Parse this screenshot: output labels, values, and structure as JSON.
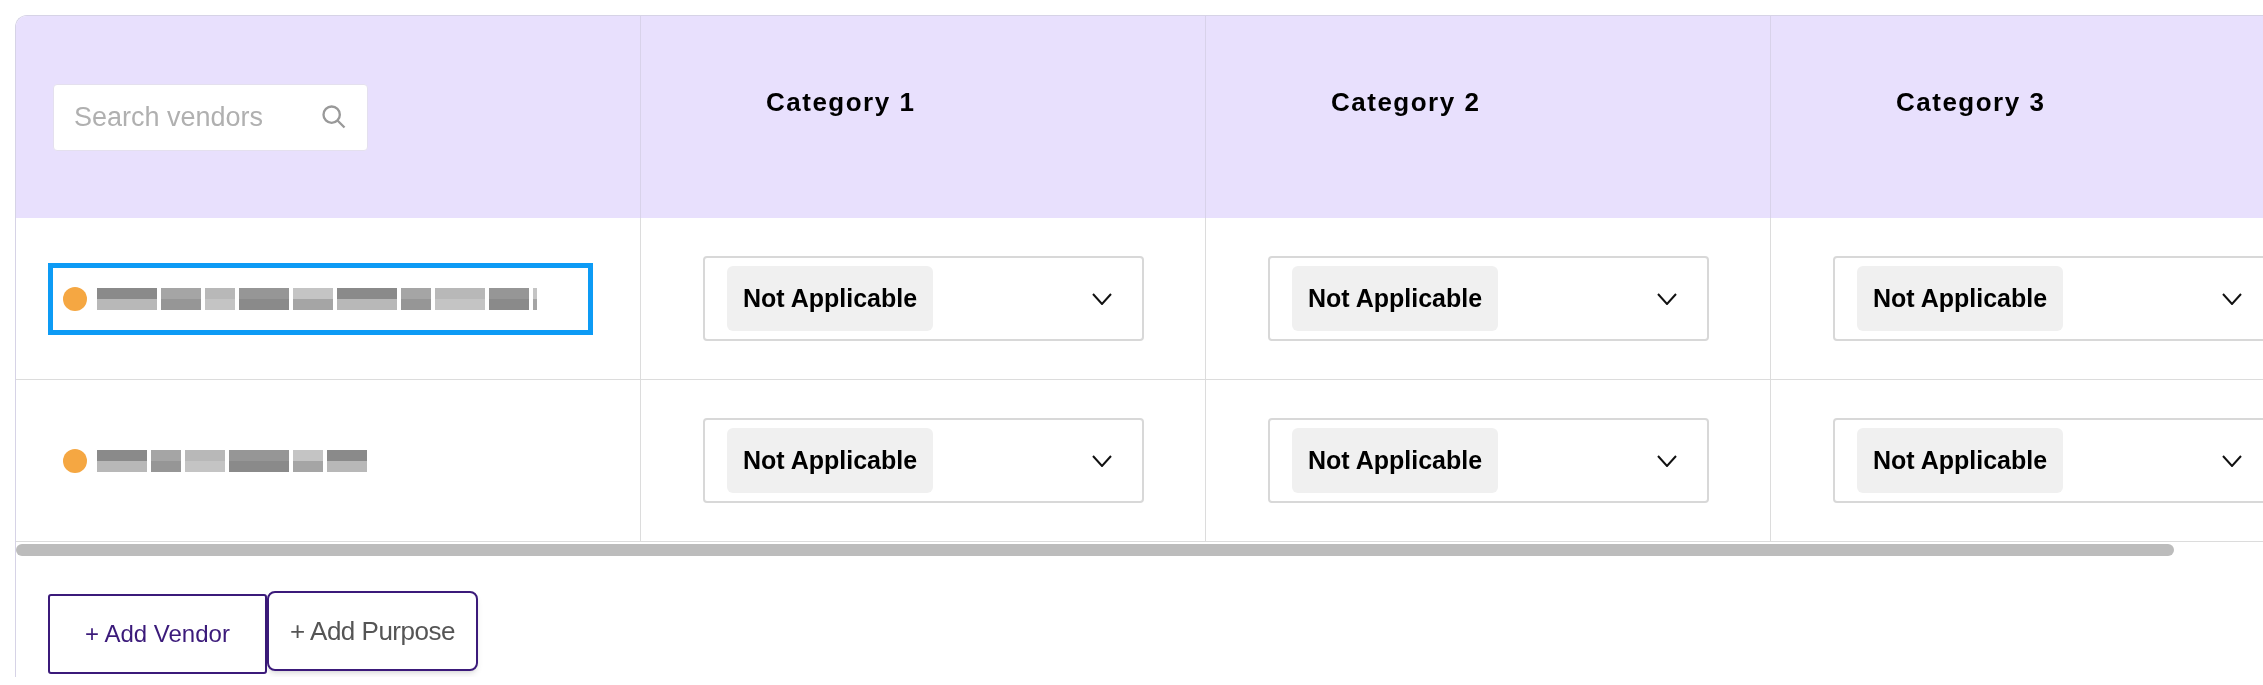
{
  "search": {
    "placeholder": "Search vendors"
  },
  "columns": [
    "Category 1",
    "Category 2",
    "Category 3"
  ],
  "rows": [
    {
      "selected": true,
      "color": "#f5a742",
      "cells": [
        "Not Applicable",
        "Not Applicable",
        "Not Applicable"
      ]
    },
    {
      "selected": false,
      "color": "#f5a742",
      "cells": [
        "Not Applicable",
        "Not Applicable",
        "Not Applicable"
      ]
    }
  ],
  "buttons": [
    {
      "kind": "vendor",
      "label": "+ Add Vendor"
    },
    {
      "kind": "purpose",
      "label": "+ Add Purpose"
    }
  ]
}
